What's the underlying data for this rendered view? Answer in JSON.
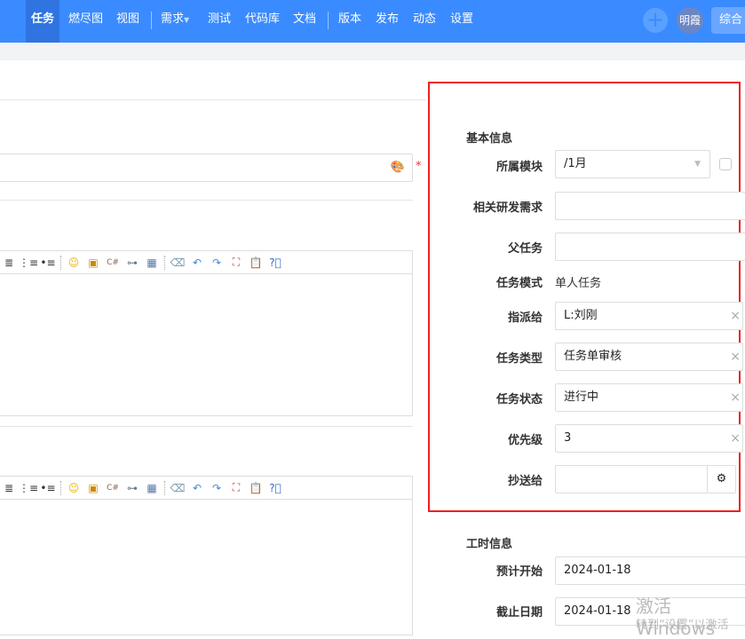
{
  "nav": {
    "items": [
      "任务",
      "燃尽图",
      "视图",
      "需求",
      "测试",
      "代码库",
      "文档",
      "版本",
      "发布",
      "动态",
      "设置"
    ],
    "avatar": "明霞",
    "combo": "综合"
  },
  "form": {
    "required_mark": "*"
  },
  "toolbar_icons": [
    "align-justify-icon",
    "ordered-list-icon",
    "unordered-list-icon",
    "emoticon-icon",
    "image-icon",
    "code-icon",
    "link-icon",
    "table-icon",
    "eraser-icon",
    "undo-icon",
    "redo-icon",
    "fullscreen-icon",
    "paste-icon",
    "help-icon"
  ],
  "basic": {
    "title": "基本信息",
    "module_label": "所属模块",
    "module_value": "/1月",
    "story_label": "相关研发需求",
    "story_value": "",
    "parent_label": "父任务",
    "parent_value": "",
    "mode_label": "任务模式",
    "mode_value": "单人任务",
    "assign_label": "指派给",
    "assign_value": "L:刘刚",
    "type_label": "任务类型",
    "type_value": "任务单审核",
    "status_label": "任务状态",
    "status_value": "进行中",
    "pri_label": "优先级",
    "pri_value": "3",
    "cc_label": "抄送给",
    "cc_value": ""
  },
  "effort": {
    "title": "工时信息",
    "start_label": "预计开始",
    "start_value": "2024-01-18",
    "deadline_label": "截止日期",
    "deadline_value": "2024-01-18"
  },
  "watermark": {
    "line1": "激活 Windows",
    "line2": "转到“设置”以激活"
  }
}
